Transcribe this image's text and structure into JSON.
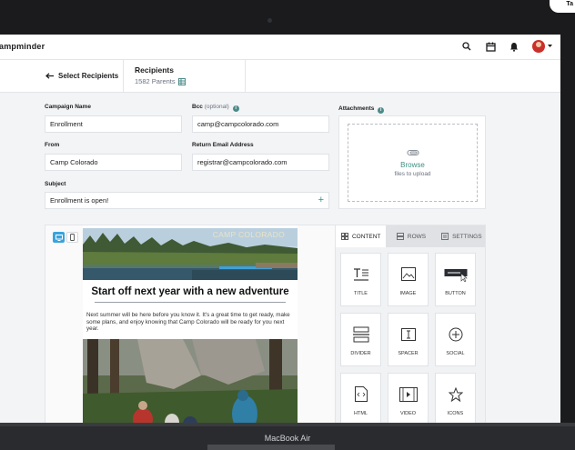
{
  "corner_text": "Ta",
  "app": {
    "brand": "ampminder"
  },
  "topbar": {
    "icons": [
      "search-icon",
      "calendar-icon",
      "bell-icon",
      "avatar",
      "chevron-down-icon"
    ]
  },
  "subbar": {
    "back_label": "Select Recipients",
    "recipients_title": "Recipients",
    "recipients_count": "1582 Parents"
  },
  "form": {
    "campaign_name_label": "Campaign Name",
    "campaign_name_value": "Enrollment",
    "bcc_label": "Bcc",
    "bcc_optional": "(optional)",
    "bcc_value": "camp@campcolorado.com",
    "from_label": "From",
    "from_value": "Camp Colorado",
    "return_label": "Return Email Address",
    "return_value": "registrar@campcolorado.com",
    "subject_label": "Subject",
    "subject_value": "Enrollment is open!",
    "attachments_label": "Attachments",
    "browse_label": "Browse",
    "upload_label": "files to upload"
  },
  "email": {
    "logo": "CAMP COLORADO",
    "headline": "Start off next year with a new adventure",
    "body": "Next summer will be here before you know it. It's a great time to get ready, make some plans, and enjoy knowing that Camp Colorado will be ready for you next year."
  },
  "builder": {
    "tabs": [
      "CONTENT",
      "ROWS",
      "SETTINGS"
    ],
    "tiles": [
      "TITLE",
      "IMAGE",
      "BUTTON",
      "DIVIDER",
      "SPACER",
      "SOCIAL",
      "HTML",
      "VIDEO",
      "ICONS"
    ]
  },
  "device": {
    "name": "MacBook Air"
  },
  "colors": {
    "accent": "#3d8f84",
    "device_toggle": "#3aa3dd",
    "bezel": "#1b1b1d"
  }
}
